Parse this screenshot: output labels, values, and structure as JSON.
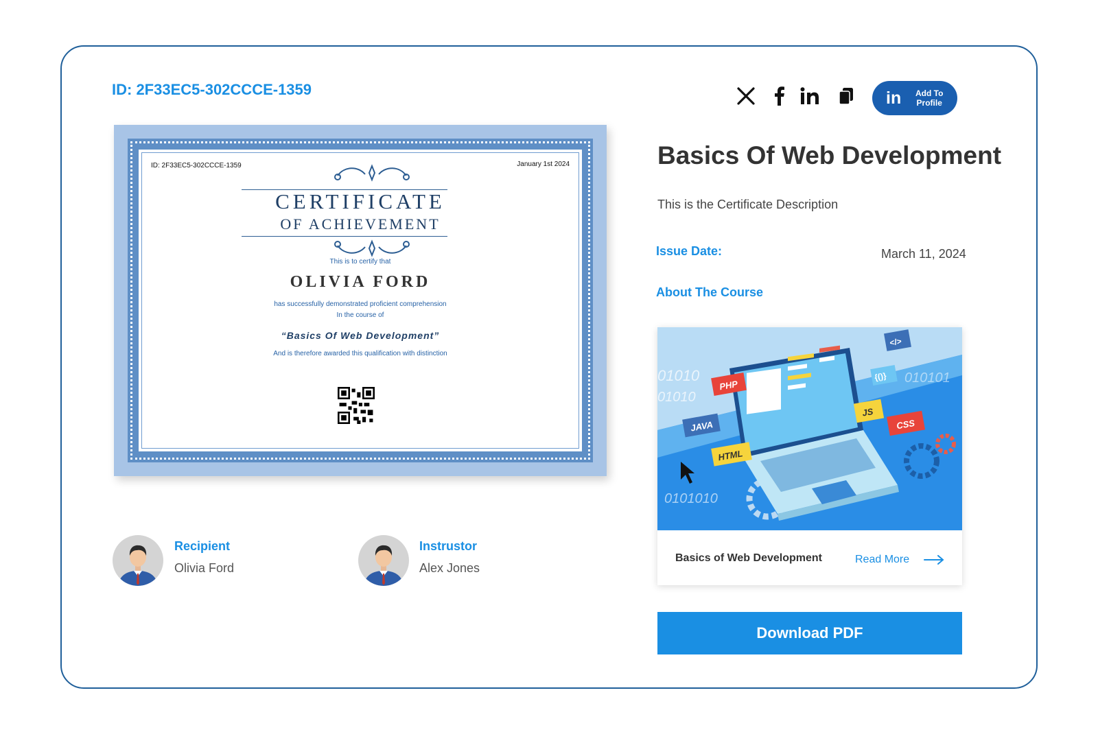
{
  "certificate_id_label": "ID: 2F33EC5-302CCCE-1359",
  "social": {
    "x_icon": "x-icon",
    "facebook_icon": "facebook-icon",
    "linkedin_icon": "linkedin-icon",
    "copy_icon": "copy-icon",
    "add_profile_icon_text": "in",
    "add_profile_label": "Add To Profile"
  },
  "certificate": {
    "id_text": "ID: 2F33EC5-302CCCE-1359",
    "date_text": "January 1st 2024",
    "title": "CERTIFICATE",
    "subtitle": "OF ACHIEVEMENT",
    "certify_text": "This is to certify that",
    "recipient_name": "OLIVIA FORD",
    "line1": "has successfully demonstrated proficient comprehension",
    "line2": "In the course of",
    "course": "“Basics Of Web Development”",
    "line3": "And is therefore awarded this qualification with distinction"
  },
  "people": {
    "recipient_role": "Recipient",
    "recipient_name": "Olivia Ford",
    "instructor_role": "Instrustor",
    "instructor_name": "Alex Jones"
  },
  "course": {
    "title": "Basics Of Web Development",
    "description": "This is the Certificate Description",
    "issue_label": "Issue Date:",
    "issue_value": "March 11, 2024",
    "about_label": "About The Course",
    "card_name": "Basics of Web Development",
    "read_more": "Read More",
    "image_tags": [
      "PHP",
      "JAVA",
      "HTML",
      "JS",
      "CSS",
      "</>",
      "{()}"
    ],
    "binary_text": [
      "01010",
      "01010",
      "010101",
      "0101010"
    ]
  },
  "download_label": "Download PDF",
  "colors": {
    "accent": "#1a8fe3",
    "border": "#1f5f9a",
    "linkedin": "#1a5fb0"
  }
}
